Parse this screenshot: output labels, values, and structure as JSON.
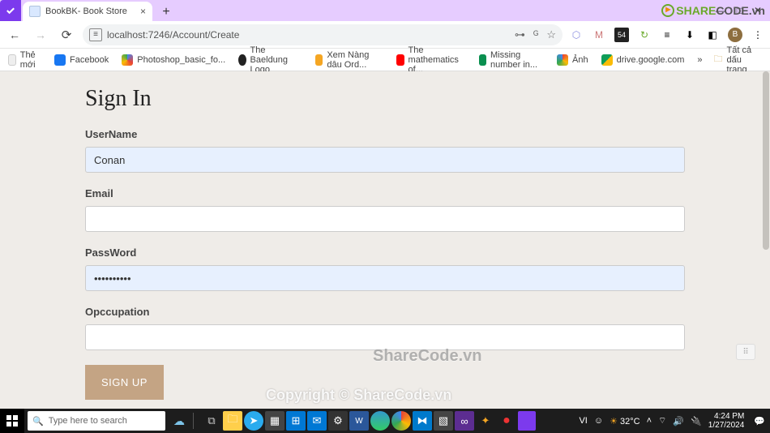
{
  "browser": {
    "tab_title": "BookBK- Book Store",
    "url": "localhost:7246/Account/Create",
    "win_min": "—",
    "win_max": "□",
    "win_close": "✕",
    "new_tab": "+"
  },
  "addr_icons": {
    "back": "←",
    "forward": "→",
    "reload": "⟳",
    "translate": "⟳",
    "star": "☆",
    "key": "⊶"
  },
  "bookmarks": {
    "items": [
      {
        "label": "Thẻ mới",
        "color": "#999"
      },
      {
        "label": "Facebook",
        "color": "#1877f2"
      },
      {
        "label": "Photoshop_basic_fo...",
        "color": "#4285f4"
      },
      {
        "label": "The Baeldung Logo",
        "color": "#222"
      },
      {
        "label": "Xem Nàng dâu Ord...",
        "color": "#f5a623"
      },
      {
        "label": "The mathematics of...",
        "color": "#ff0000"
      },
      {
        "label": "Missing number in...",
        "color": "#0a8f4f"
      },
      {
        "label": "Ảnh",
        "color": "#ea4335"
      },
      {
        "label": "drive.google.com",
        "color": "#0f9d58"
      }
    ],
    "overflow": "»",
    "all": "Tất cả dấu trang"
  },
  "form": {
    "title": "Sign In",
    "fields": {
      "username": {
        "label": "UserName",
        "value": "Conan"
      },
      "email": {
        "label": "Email",
        "value": ""
      },
      "password": {
        "label": "PassWord",
        "value": "••••••••••"
      },
      "occupation": {
        "label": "Opccupation",
        "value": ""
      }
    },
    "submit": "SIGN UP"
  },
  "watermark": {
    "w1": "ShareCode.vn",
    "w2": "Copyright © ShareCode.vn",
    "logo1": "SHARE",
    "logo2": "CODE.vn"
  },
  "taskbar": {
    "search_placeholder": "Type here to search",
    "lang": "VI",
    "ime": "☺",
    "temp": "32°C",
    "time": "4:24 PM",
    "date": "1/27/2024"
  }
}
